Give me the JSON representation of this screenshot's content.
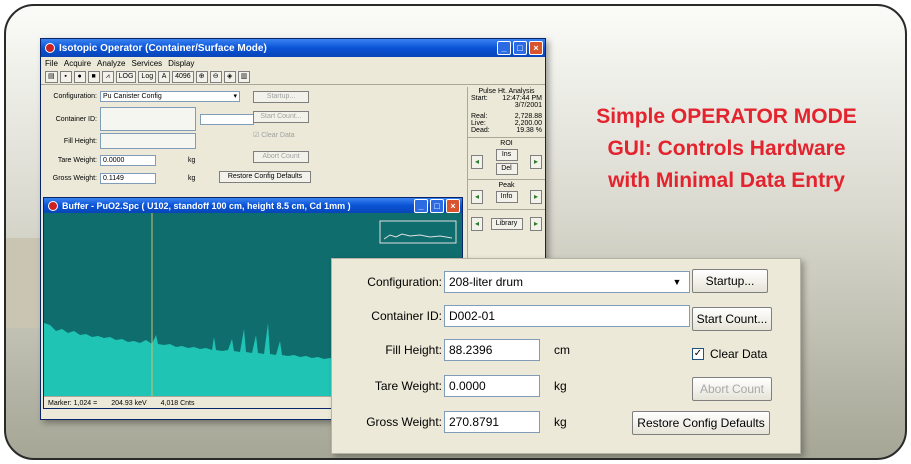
{
  "window": {
    "title": "Isotopic Operator (Container/Surface Mode)",
    "menu": [
      "File",
      "Acquire",
      "Analyze",
      "Services",
      "Display"
    ],
    "toolbar": [
      "LOG",
      "Log",
      "A",
      "4096"
    ]
  },
  "small_form": {
    "configuration_label": "Configuration:",
    "configuration_value": "Pu Canister Config",
    "container_label": "Container ID:",
    "fill_label": "Fill Height:",
    "tare_label": "Tare Weight:",
    "tare_value": "0.0000",
    "tare_unit": "kg",
    "gross_label": "Gross Weight:",
    "gross_value": "0.1149",
    "gross_unit": "kg",
    "startup": "Startup...",
    "start_count": "Start Count...",
    "clear_data": "Clear Data",
    "abort_count": "Abort Count",
    "restore": "Restore Config Defaults"
  },
  "side_panel": {
    "title": "Pulse Ht. Analysis",
    "start_label": "Start:",
    "start_time": "12:47:44 PM",
    "start_date": "3/7/2001",
    "real_label": "Real:",
    "real_value": "2,728.88",
    "live_label": "Live:",
    "live_value": "2,200.00",
    "dead_label": "Dead:",
    "dead_value": "19.38 %",
    "roi_label": "ROI",
    "ins_label": "Ins",
    "del_label": "Del",
    "peak_label": "Peak",
    "info_label": "Info",
    "library_label": "Library"
  },
  "buffer": {
    "title": "Buffer - PuO2.Spc ( U102, standoff 100 cm, height 8.5 cm, Cd 1mm )",
    "marker": "Marker:  1,024  =",
    "energy": "204.93 keV",
    "counts": "4,018  Cnts"
  },
  "headline": {
    "line1": "Simple OPERATOR MODE",
    "line2": "GUI: Controls Hardware",
    "line3": "with Minimal Data Entry"
  },
  "zoom_form": {
    "configuration_label": "Configuration:",
    "configuration_value": "208-liter drum",
    "container_label": "Container ID:",
    "container_value": "D002-01",
    "fill_label": "Fill Height:",
    "fill_value": "88.2396",
    "fill_unit": "cm",
    "tare_label": "Tare Weight:",
    "tare_value": "0.0000",
    "tare_unit": "kg",
    "gross_label": "Gross Weight:",
    "gross_value": "270.8791",
    "gross_unit": "kg",
    "startup": "Startup...",
    "start_count": "Start Count...",
    "clear_data": "Clear Data",
    "abort_count": "Abort Count",
    "restore": "Restore Config Defaults"
  },
  "colors": {
    "headline": "#e3232e",
    "titlebar": "#0a53d6",
    "spectrum": "#20c4b4"
  }
}
